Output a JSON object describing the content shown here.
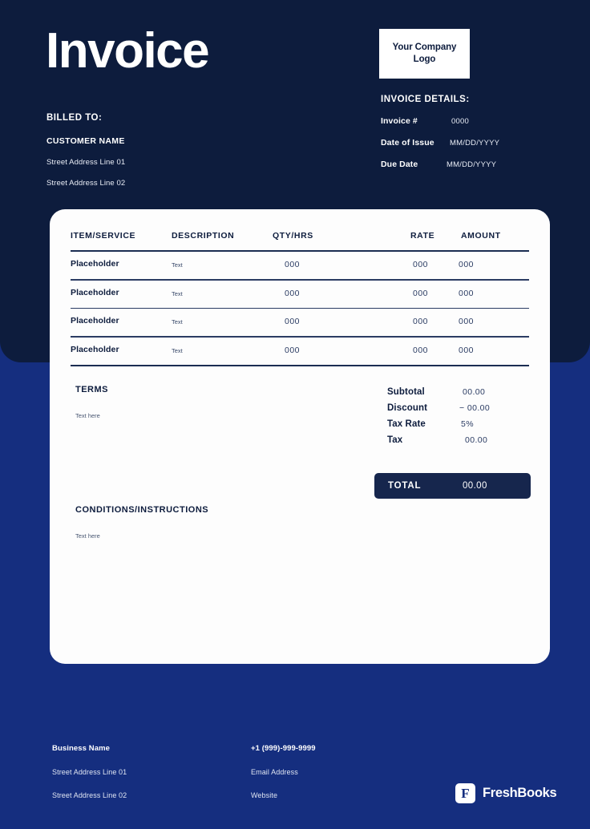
{
  "document": {
    "title": "Invoice"
  },
  "logo": {
    "line1": "Your Company",
    "line2": "Logo"
  },
  "billed_to": {
    "heading": "BILLED TO:",
    "customer_name": "CUSTOMER NAME",
    "address_line_1": "Street Address Line 01",
    "address_line_2": "Street Address Line 02"
  },
  "invoice_details": {
    "heading": "INVOICE DETAILS:",
    "rows": [
      {
        "label": "Invoice #",
        "value": "0000"
      },
      {
        "label": "Date of Issue",
        "value": "MM/DD/YYYY"
      },
      {
        "label": "Due Date",
        "value": "MM/DD/YYYY"
      }
    ]
  },
  "items_table": {
    "columns": [
      "ITEM/SERVICE",
      "DESCRIPTION",
      "QTY/HRS",
      "RATE",
      "AMOUNT"
    ],
    "rows": [
      {
        "item": "Placeholder",
        "description": "Text",
        "qty": "000",
        "rate": "000",
        "amount": "000"
      },
      {
        "item": "Placeholder",
        "description": "Text",
        "qty": "000",
        "rate": "000",
        "amount": "000"
      },
      {
        "item": "Placeholder",
        "description": "Text",
        "qty": "000",
        "rate": "000",
        "amount": "000"
      },
      {
        "item": "Placeholder",
        "description": "Text",
        "qty": "000",
        "rate": "000",
        "amount": "000"
      }
    ]
  },
  "terms": {
    "heading": "TERMS",
    "body": "Text here"
  },
  "conditions": {
    "heading": "CONDITIONS/INSTRUCTIONS",
    "body": "Text here"
  },
  "totals": {
    "subtotal_label": "Subtotal",
    "subtotal_value": "00.00",
    "discount_label": "Discount",
    "discount_value": "− 00.00",
    "tax_rate_label": "Tax Rate",
    "tax_rate_value": "5%",
    "tax_label": "Tax",
    "tax_value": "00.00",
    "total_label": "TOTAL",
    "total_value": "00.00"
  },
  "footer": {
    "business_name": "Business Name",
    "address_line_1": "Street Address Line 01",
    "address_line_2": "Street Address Line 02",
    "phone": "+1 (999)-999-9999",
    "email": "Email Address",
    "website": "Website",
    "brand": "FreshBooks",
    "brand_mark": "F"
  },
  "colors": {
    "header_navy": "#0d1c3d",
    "body_blue": "#152e7f",
    "card_white": "#fdfdfd",
    "total_bar": "#16264d"
  }
}
